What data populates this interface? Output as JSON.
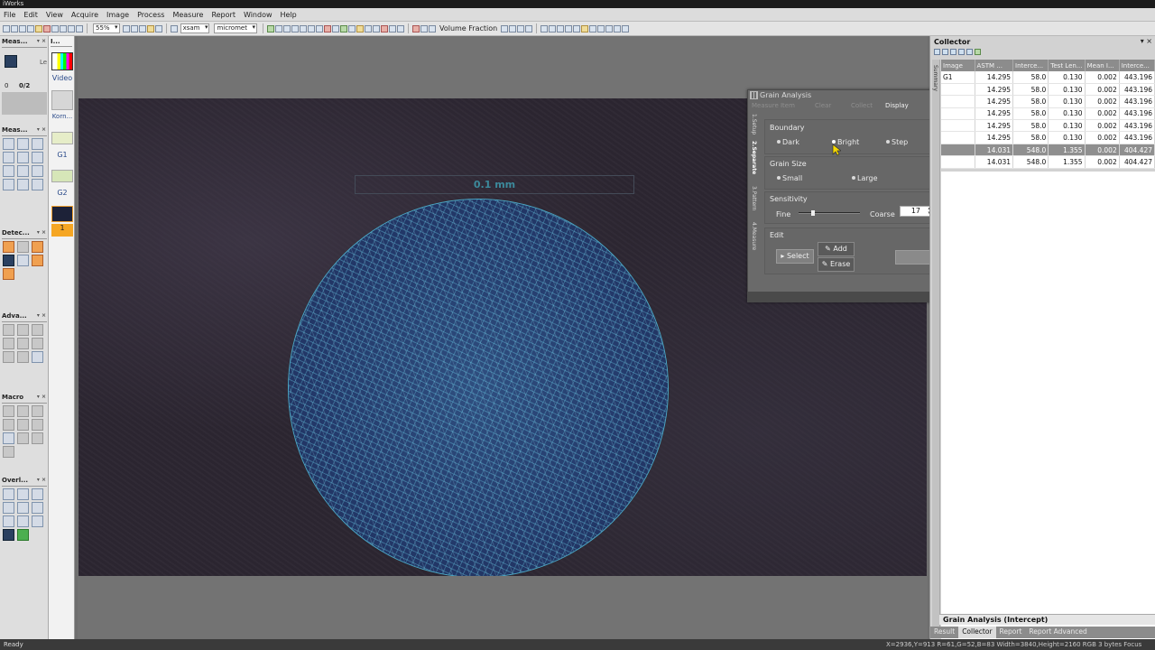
{
  "app": {
    "title": "iWorks"
  },
  "menu": [
    "File",
    "Edit",
    "View",
    "Acquire",
    "Image",
    "Process",
    "Measure",
    "Report",
    "Window",
    "Help"
  ],
  "toolbar": {
    "zoom": "55%",
    "unit_x": "xsam",
    "unit_y": "micromet",
    "volume_fraction_label": "Volume Fraction"
  },
  "left_panel": {
    "meas_header": "Meas...",
    "image_header": "I...",
    "counter_label": "0",
    "counter_value": "0/2",
    "le_label": "Le",
    "video_label": "Video",
    "korn_label": "Korn...",
    "g1_label": "G1",
    "g2_label": "G2",
    "one_label": "1",
    "measure_tools_header": "Meas...",
    "detect_header": "Detec...",
    "advanced_header": "Adva...",
    "macro_header": "Macro",
    "overlay_header": "Overl..."
  },
  "canvas": {
    "scale_label": "0.1 mm"
  },
  "dialog": {
    "title": "Grain Analysis",
    "top_measure_item": "Measure Item",
    "top_clear": "Clear",
    "top_collect": "Collect",
    "top_display": "Display",
    "vtabs": [
      "1.Setup",
      "2.Separate",
      "3.Pattern",
      "4.Measure"
    ],
    "boundary": {
      "label": "Boundary",
      "options": [
        "Dark",
        "Bright",
        "Step"
      ],
      "selected": "Bright"
    },
    "grain_size": {
      "label": "Grain Size",
      "options": [
        "Small",
        "Large"
      ]
    },
    "sensitivity": {
      "label": "Sensitivity",
      "fine_label": "Fine",
      "coarse_label": "Coarse",
      "value": "17"
    },
    "edit": {
      "label": "Edit",
      "select_label": "Select",
      "add_label": "Add",
      "erase_label": "Erase"
    }
  },
  "collector": {
    "title": "Collector",
    "side_label": "Summary",
    "columns": [
      "Image",
      "ASTM ...",
      "Interce...",
      "Test Len...",
      "Mean I...",
      "Interce..."
    ],
    "rows": [
      [
        "G1",
        "14.295",
        "58.0",
        "0.130",
        "0.002",
        "443.196"
      ],
      [
        "",
        "14.295",
        "58.0",
        "0.130",
        "0.002",
        "443.196"
      ],
      [
        "",
        "14.295",
        "58.0",
        "0.130",
        "0.002",
        "443.196"
      ],
      [
        "",
        "14.295",
        "58.0",
        "0.130",
        "0.002",
        "443.196"
      ],
      [
        "",
        "14.295",
        "58.0",
        "0.130",
        "0.002",
        "443.196"
      ],
      [
        "",
        "14.295",
        "58.0",
        "0.130",
        "0.002",
        "443.196"
      ],
      [
        "",
        "14.031",
        "548.0",
        "1.355",
        "0.002",
        "404.427"
      ],
      [
        "",
        "14.031",
        "548.0",
        "1.355",
        "0.002",
        "404.427"
      ]
    ],
    "selected_row": 6,
    "footer_title": "Grain Analysis (Intercept)",
    "tabs": [
      "Result",
      "Collector",
      "Report",
      "Report Advanced"
    ],
    "active_tab": "Collector"
  },
  "status": {
    "left": "Ready",
    "right": "X=2936,Y=913  R=61,G=52,B=83  Width=3840,Height=2160  RGB 3 bytes  Focus"
  },
  "colors": {
    "accent_blue": "#2f4f80",
    "grain_boundary": "#6ed2eb",
    "dialog_bg": "#6a6a6a",
    "selected_row": "#8f8f8f"
  }
}
